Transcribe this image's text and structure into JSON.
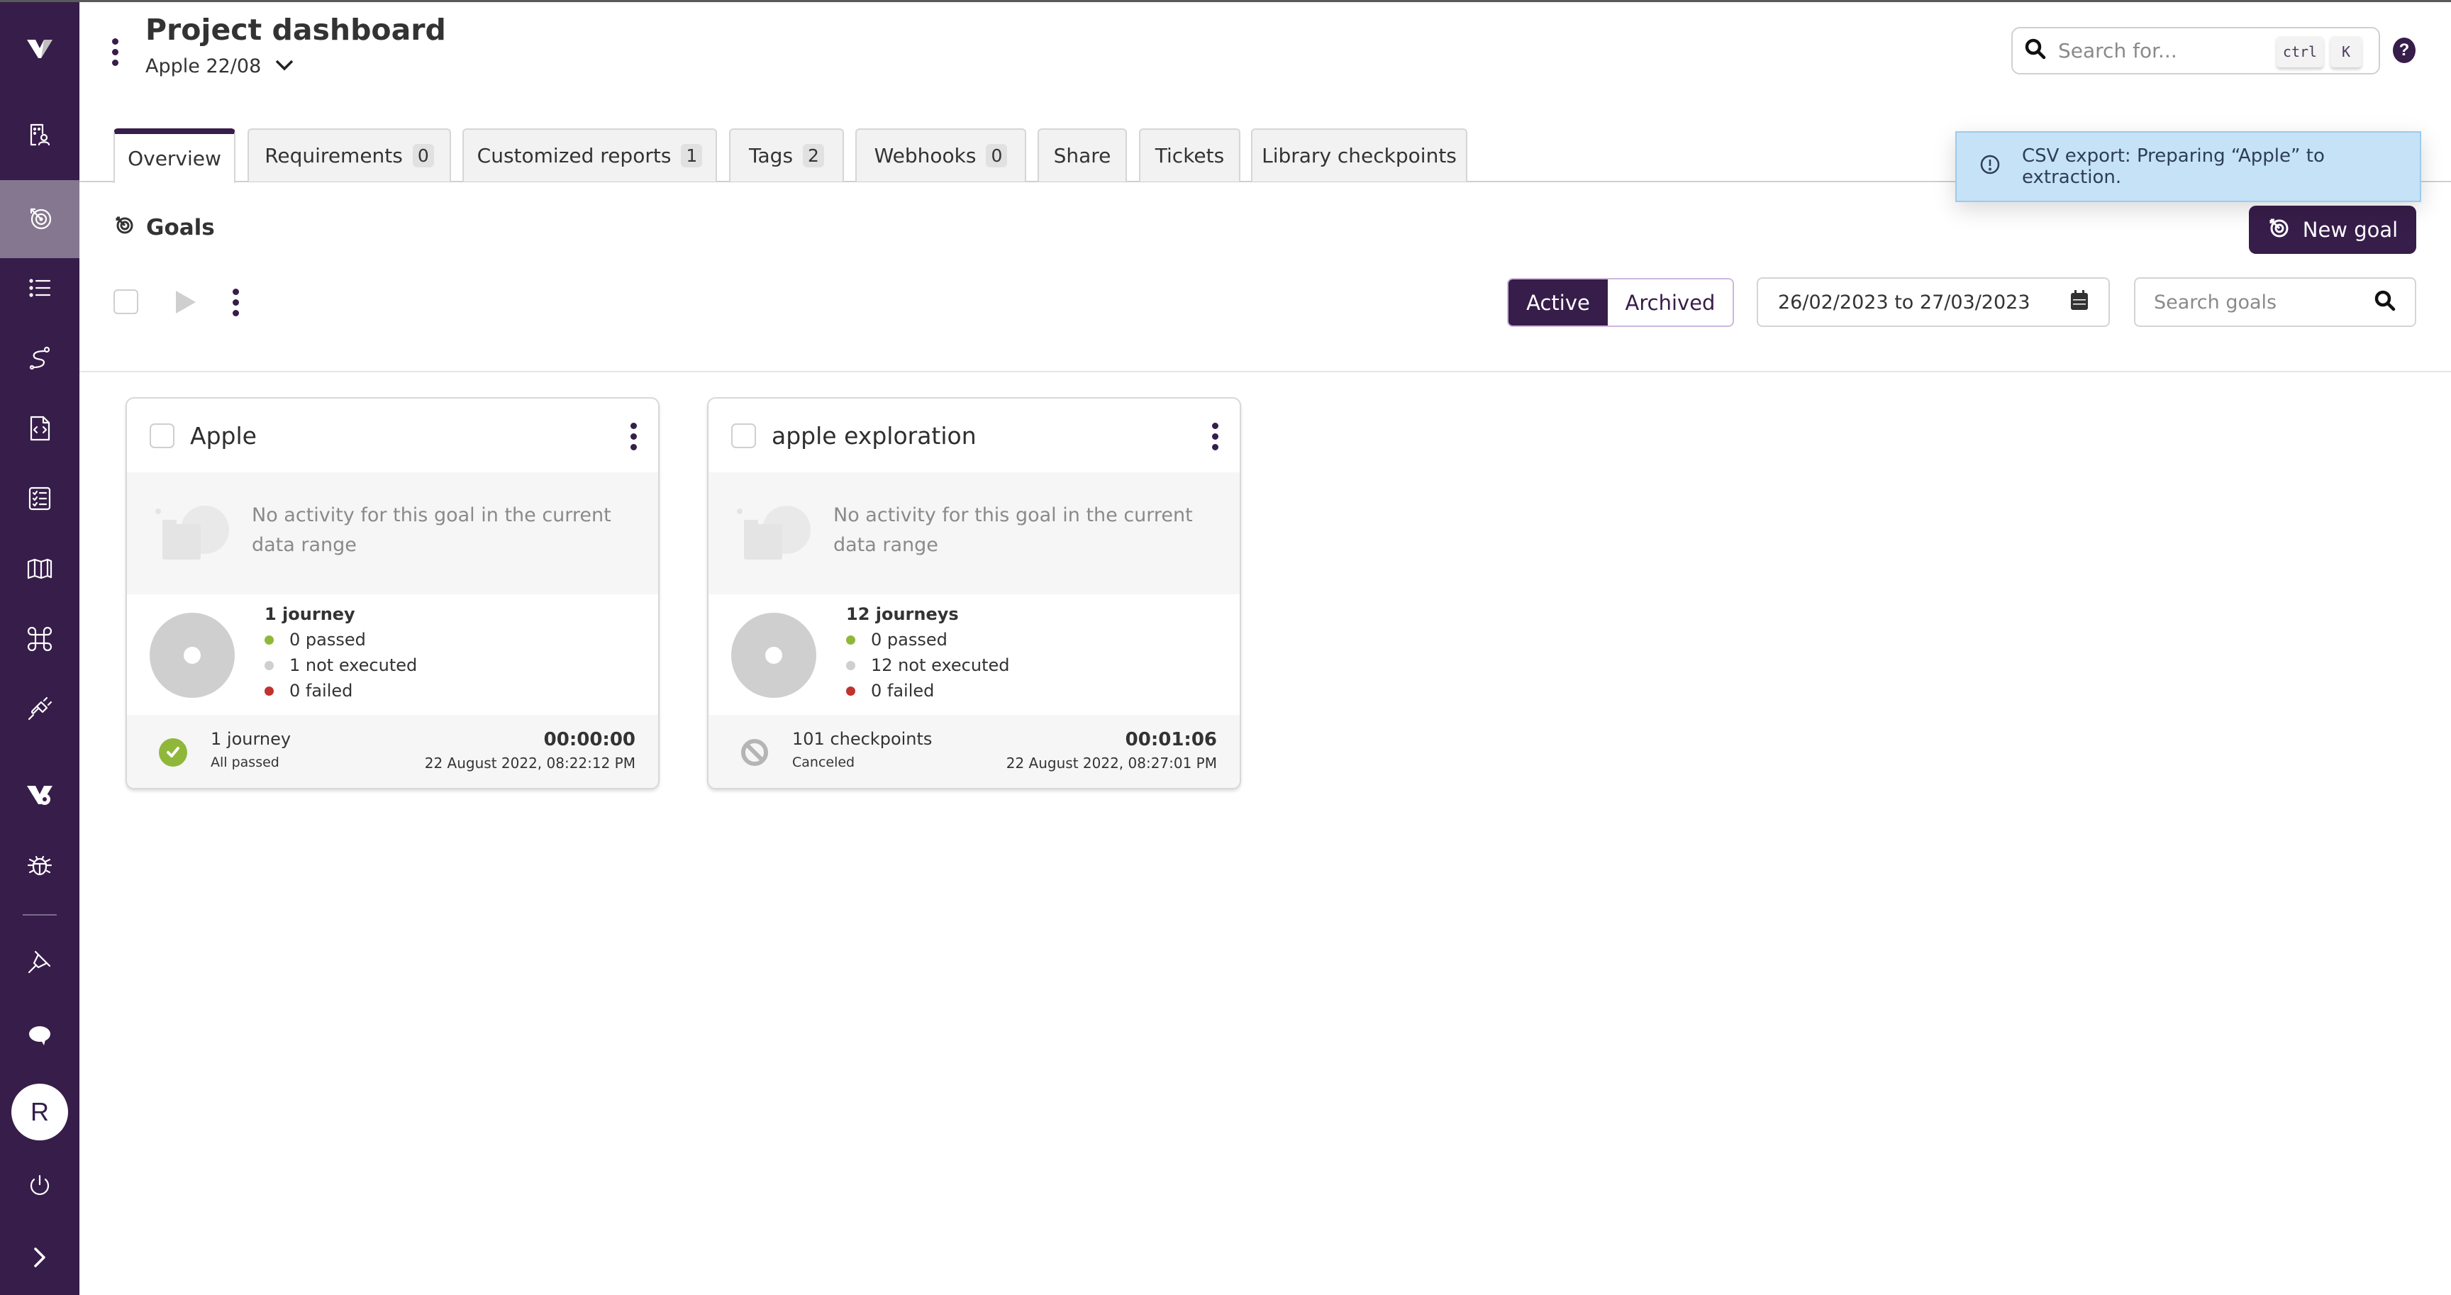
{
  "header": {
    "title": "Project dashboard",
    "project": "Apple 22/08",
    "search_placeholder": "Search for...",
    "shortcut_keys": [
      "ctrl",
      "K"
    ],
    "help_label": "?"
  },
  "sidebar": {
    "items": [
      {
        "id": "logo",
        "icon": "virtuoso-logo-icon"
      },
      {
        "id": "organization",
        "icon": "organization-user-icon"
      },
      {
        "id": "goals",
        "icon": "target-icon",
        "active": true
      },
      {
        "id": "list",
        "icon": "list-icon"
      },
      {
        "id": "journeys",
        "icon": "route-icon"
      },
      {
        "id": "code",
        "icon": "code-file-icon"
      },
      {
        "id": "checklist",
        "icon": "checklist-icon"
      },
      {
        "id": "map",
        "icon": "map-icon"
      },
      {
        "id": "commands",
        "icon": "command-icon"
      },
      {
        "id": "integrations",
        "icon": "plug-icon"
      },
      {
        "id": "settings",
        "icon": "virtuoso-gear-icon"
      },
      {
        "id": "bugs",
        "icon": "bug-icon"
      },
      {
        "id": "pin",
        "icon": "pin-icon"
      },
      {
        "id": "chat",
        "icon": "chat-icon"
      },
      {
        "id": "power",
        "icon": "power-icon"
      },
      {
        "id": "expand",
        "icon": "chevron-right-icon"
      }
    ],
    "avatar_initial": "R"
  },
  "tabs": [
    {
      "label": "Overview",
      "active": true
    },
    {
      "label": "Requirements",
      "count": "0"
    },
    {
      "label": "Customized reports",
      "count": "1"
    },
    {
      "label": "Tags",
      "count": "2"
    },
    {
      "label": "Webhooks",
      "count": "0"
    },
    {
      "label": "Share"
    },
    {
      "label": "Tickets"
    },
    {
      "label": "Library checkpoints"
    }
  ],
  "toast": {
    "message": "CSV export: Preparing “Apple” to extraction."
  },
  "goals": {
    "heading": "Goals",
    "new_goal_label": "New goal",
    "filter_active": "Active",
    "filter_archived": "Archived",
    "date_range": "26/02/2023 to 27/03/2023",
    "search_placeholder": "Search goals"
  },
  "colors": {
    "brand": "#371d4a",
    "passed": "#8fb83a",
    "not_executed": "#cfcfcf",
    "failed": "#c0332e",
    "toast_bg": "#c6e2f6"
  },
  "cards": [
    {
      "title": "Apple",
      "empty_message": "No activity for this goal in the current data range",
      "total": "1 journey",
      "passed": "0 passed",
      "not_executed": "1 not executed",
      "failed": "0 failed",
      "last_run_main": "1 journey",
      "last_run_status": "All passed",
      "last_run_icon": "check-circle-icon",
      "duration": "00:00:00",
      "date": "22 August 2022, 08:22:12 PM"
    },
    {
      "title": "apple exploration",
      "empty_message": "No activity for this goal in the current data range",
      "total": "12 journeys",
      "passed": "0 passed",
      "not_executed": "12 not executed",
      "failed": "0 failed",
      "last_run_main": "101 checkpoints",
      "last_run_status": "Canceled",
      "last_run_icon": "canceled-icon",
      "duration": "00:01:06",
      "date": "22 August 2022, 08:27:01 PM"
    }
  ]
}
